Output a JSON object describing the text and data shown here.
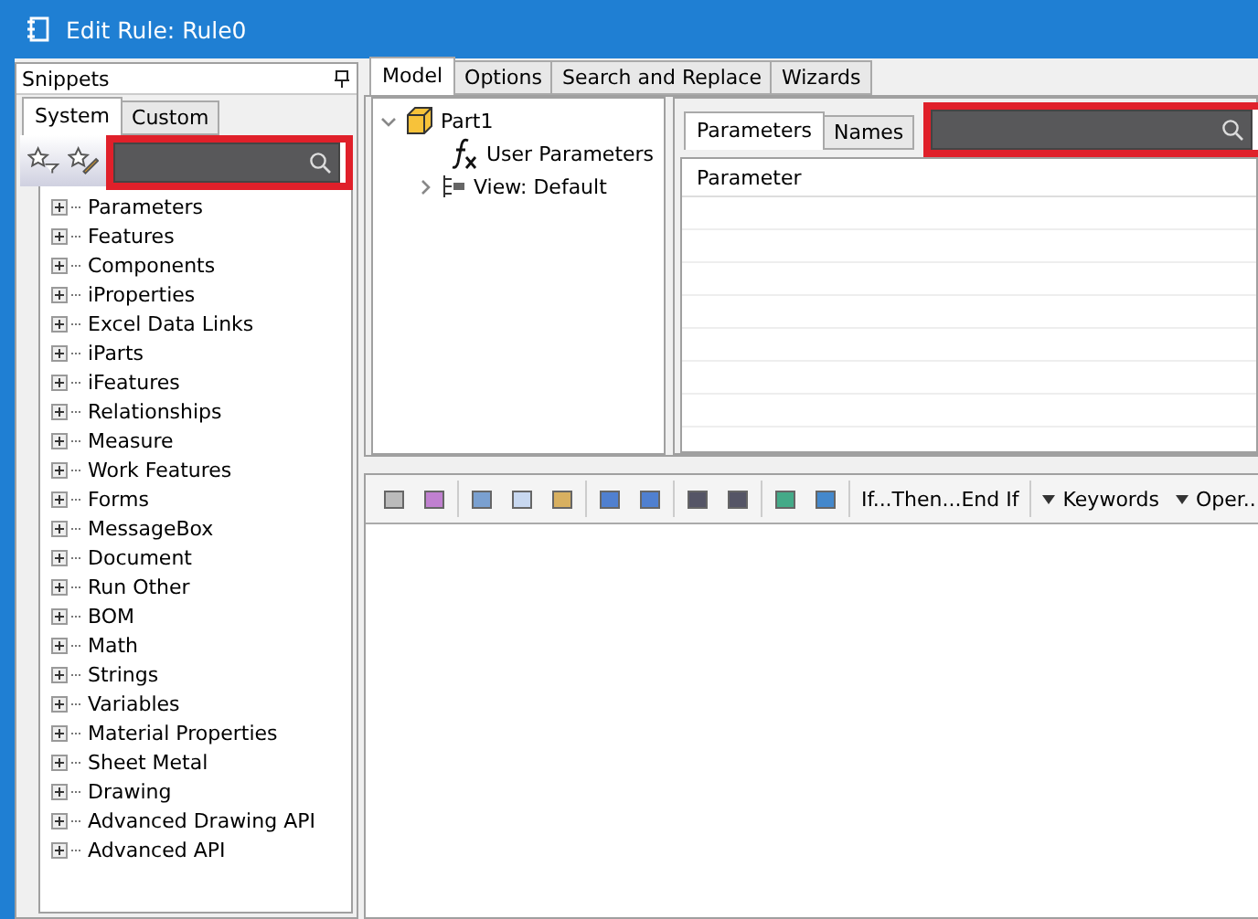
{
  "window": {
    "title": "Edit Rule: Rule0"
  },
  "snippets": {
    "title": "Snippets",
    "tabs": [
      {
        "label": "System",
        "selected": true
      },
      {
        "label": "Custom",
        "selected": false
      }
    ],
    "search": {
      "highlighted": true
    },
    "items": [
      {
        "label": "Parameters"
      },
      {
        "label": "Features"
      },
      {
        "label": "Components"
      },
      {
        "label": "iProperties"
      },
      {
        "label": "Excel Data Links"
      },
      {
        "label": "iParts"
      },
      {
        "label": "iFeatures"
      },
      {
        "label": "Relationships"
      },
      {
        "label": "Measure"
      },
      {
        "label": "Work Features"
      },
      {
        "label": "Forms"
      },
      {
        "label": "MessageBox"
      },
      {
        "label": "Document"
      },
      {
        "label": "Run Other"
      },
      {
        "label": "BOM"
      },
      {
        "label": "Math"
      },
      {
        "label": "Strings"
      },
      {
        "label": "Variables"
      },
      {
        "label": "Material Properties"
      },
      {
        "label": "Sheet Metal"
      },
      {
        "label": "Drawing"
      },
      {
        "label": "Advanced Drawing API"
      },
      {
        "label": "Advanced API"
      }
    ]
  },
  "main_tabs": [
    {
      "label": "Model",
      "selected": true
    },
    {
      "label": "Options",
      "selected": false
    },
    {
      "label": "Search and Replace",
      "selected": false
    },
    {
      "label": "Wizards",
      "selected": false
    }
  ],
  "model_tree": [
    {
      "label": "Part1",
      "kind": "part",
      "expanded": true
    },
    {
      "label": "User Parameters",
      "kind": "params"
    },
    {
      "label": "View: Default",
      "kind": "view",
      "expanded": false
    }
  ],
  "parameters": {
    "tabs": [
      {
        "label": "Parameters",
        "selected": true
      },
      {
        "label": "Names",
        "selected": false
      }
    ],
    "search": {
      "highlighted": true
    },
    "columns": [
      "Parameter"
    ]
  },
  "toolbar": {
    "statement": "If...Then...End If",
    "menus": [
      "Keywords",
      "Oper..."
    ]
  }
}
